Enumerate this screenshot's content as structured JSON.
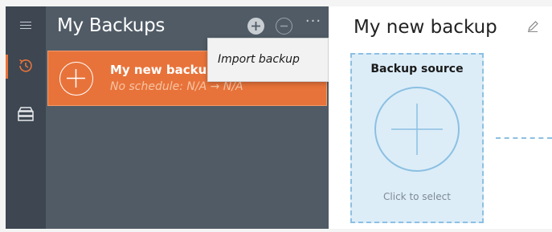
{
  "sidebar": {
    "items": [
      {
        "icon": "hamburger-menu-icon",
        "active": false
      },
      {
        "icon": "history-clock-icon",
        "active": true
      },
      {
        "icon": "storage-stack-icon",
        "active": false
      }
    ]
  },
  "list": {
    "title": "My Backups",
    "header_buttons": [
      "add-icon",
      "remove-icon",
      "more-icon"
    ],
    "more_label": "···",
    "items": [
      {
        "title": "My new backup",
        "subtitle": "No schedule: N/A → N/A",
        "selected": true
      }
    ]
  },
  "context_menu": {
    "items": [
      {
        "label": "Import backup"
      }
    ]
  },
  "detail": {
    "title": "My new backup",
    "source": {
      "title": "Backup source",
      "hint": "Click to select"
    }
  },
  "colors": {
    "accent": "#e8733a",
    "rail": "#3d4651",
    "panel": "#505b66",
    "source_bg": "#dcedf8",
    "source_border": "#8cc0e2"
  }
}
